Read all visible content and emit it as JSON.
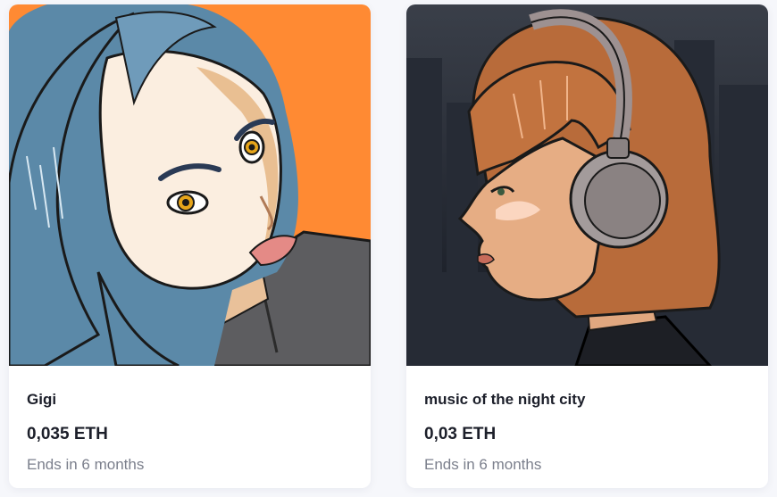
{
  "cards": [
    {
      "title": "Gigi",
      "price": "0,035 ETH",
      "ends": "Ends in 6 months",
      "artwork": "blue-haired-woman-illustration",
      "background_color": "#ff8a33"
    },
    {
      "title": "music of the night city",
      "price": "0,03 ETH",
      "ends": "Ends in 6 months",
      "artwork": "woman-with-headphones-illustration",
      "background_color": "#2a2f3a"
    }
  ],
  "colors": {
    "page_bg": "#f6f7fb",
    "card_bg": "#ffffff",
    "text_primary": "#1c1f2a",
    "text_muted": "#7b7f8c"
  }
}
